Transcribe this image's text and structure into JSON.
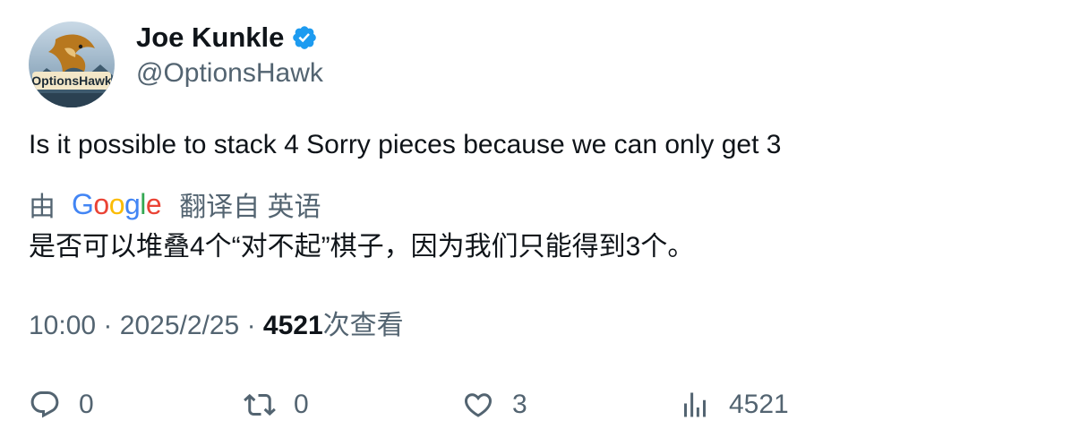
{
  "author": {
    "name": "Joe Kunkle",
    "handle": "@OptionsHawk",
    "avatar_icon": "options-hawk-avatar",
    "avatar_text": "OptionsHawk",
    "verified": true,
    "verified_color": "#1d9bf0"
  },
  "tweet": {
    "text": "Is it possible to stack 4 Sorry pieces because we can only get 3"
  },
  "translation": {
    "by_label": "由",
    "provider": "Google",
    "label": "翻译自 英语",
    "text": "是否可以堆叠4个“对不起”棋子，因为我们只能得到3个。"
  },
  "meta": {
    "time": "10:00",
    "separator": "·",
    "date": "2025/2/25",
    "views_count": "4521",
    "views_label": "次查看"
  },
  "actions": {
    "reply_count": "0",
    "retweet_count": "0",
    "like_count": "3",
    "views_count": "4521"
  },
  "colors": {
    "text": "#0f1419",
    "secondary": "#536471",
    "google_blue": "#4285F4",
    "google_red": "#EA4335",
    "google_yellow": "#FBBC05",
    "google_green": "#34A853"
  }
}
